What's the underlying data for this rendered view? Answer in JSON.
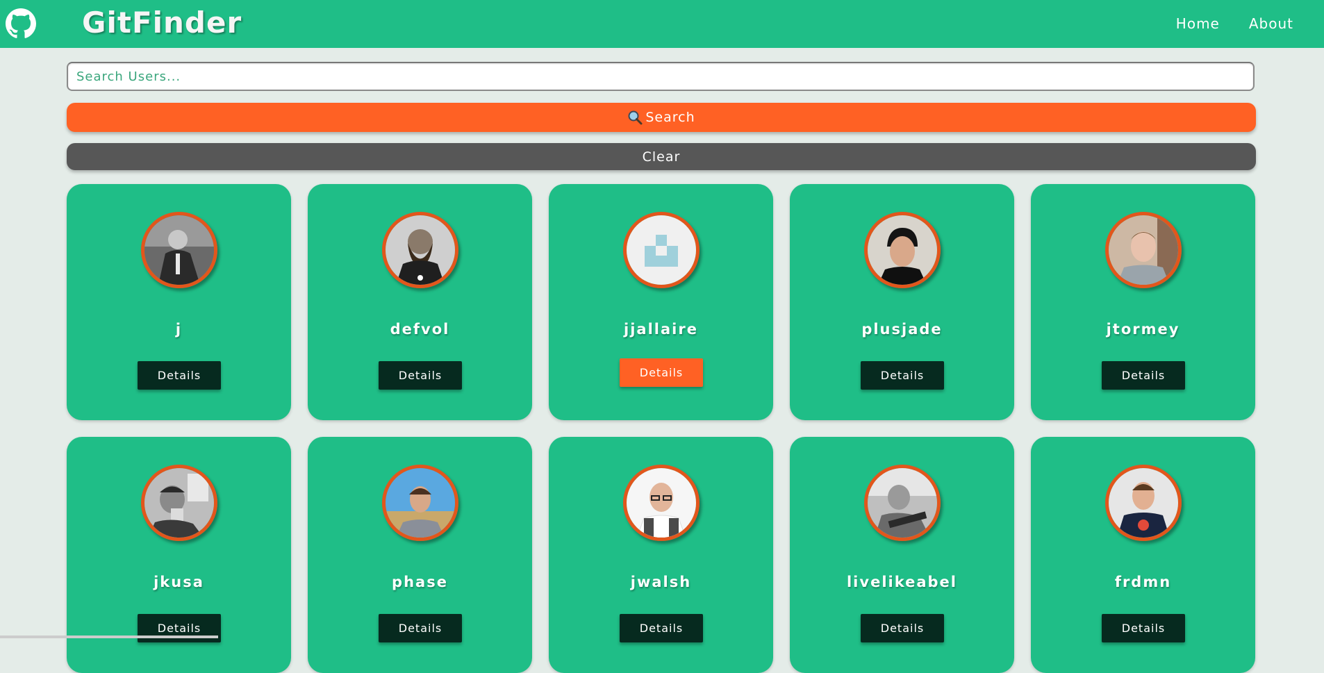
{
  "navbar": {
    "logo_icon": "github-icon",
    "title": "GitFinder",
    "links": [
      "Home",
      "About"
    ],
    "background": "#1fbe87"
  },
  "search": {
    "placeholder": "Search Users...",
    "value": "",
    "search_label": "Search",
    "search_icon": "magnifying-glass-icon",
    "clear_label": "Clear",
    "search_color": "#ff6124",
    "clear_color": "#575757"
  },
  "users": [
    {
      "login": "j",
      "avatar": "photo-bw-man-suit",
      "button": "Details"
    },
    {
      "login": "defvol",
      "avatar": "illustration-bearded-man",
      "button": "Details"
    },
    {
      "login": "jjallaire",
      "avatar": "identicon",
      "button": "Details",
      "hovered": true
    },
    {
      "login": "plusjade",
      "avatar": "photo-young-man",
      "button": "Details"
    },
    {
      "login": "jtormey",
      "avatar": "photo-man-gray-shirt",
      "button": "Details"
    },
    {
      "login": "jkusa",
      "avatar": "photo-bw-man-mug",
      "button": "Details"
    },
    {
      "login": "phase",
      "avatar": "photo-man-outdoors",
      "button": "Details"
    },
    {
      "login": "jwalsh",
      "avatar": "photo-bald-man-glasses",
      "button": "Details"
    },
    {
      "login": "livelikeabel",
      "avatar": "photo-bw-guitar",
      "button": "Details"
    },
    {
      "login": "frdmn",
      "avatar": "photo-man-navy-tshirt",
      "button": "Details"
    }
  ]
}
